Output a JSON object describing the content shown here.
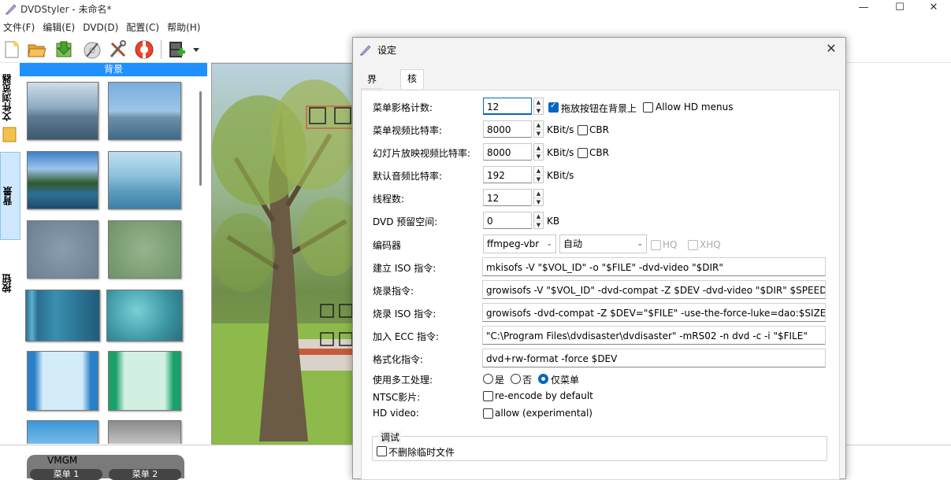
{
  "window": {
    "title": "DVDStyler - 未命名*",
    "min": "—",
    "max": "☐",
    "close": "✕"
  },
  "menu": [
    "文件(F)",
    "编辑(E)",
    "DVD(D)",
    "配置(C)",
    "帮助(H)"
  ],
  "toolbar": [
    "new-icon",
    "open-icon",
    "save-icon",
    "burn-icon",
    "settings-icon",
    "help-icon",
    "add-video-icon"
  ],
  "side_tabs": [
    "文件浏览器",
    "背景",
    "按钮"
  ],
  "background_panel": {
    "title": "背景"
  },
  "bottom": {
    "vmgm": "VMGM",
    "menus": [
      "菜单 1",
      "菜单 2"
    ]
  },
  "dialog": {
    "title": "设定",
    "close": "✕",
    "tabs": [
      "界面",
      "核心"
    ],
    "active_tab": "核心",
    "rows": {
      "menu_frame_count": {
        "label": "菜单影格计数:",
        "value": "12",
        "check1": "拖放按钮在背景上",
        "check2": "Allow HD menus"
      },
      "menu_video_bitrate": {
        "label": "菜单视频比特率:",
        "value": "8000",
        "unit": "KBit/s",
        "check": "CBR"
      },
      "slideshow_bitrate": {
        "label": "幻灯片放映视频比特率:",
        "value": "8000",
        "unit": "KBit/s",
        "check": "CBR"
      },
      "audio_bitrate": {
        "label": "默认音频比特率:",
        "value": "192",
        "unit": "KBit/s"
      },
      "threads": {
        "label": "线程数:",
        "value": "12"
      },
      "dvd_reserve": {
        "label": "DVD 预留空间:",
        "value": "0",
        "unit": "KB"
      },
      "encoder": {
        "label": "编码器",
        "value1": "ffmpeg-vbr",
        "value2": "自动",
        "hq": "HQ",
        "xhq": "XHQ"
      },
      "iso_cmd": {
        "label": "建立 ISO 指令:",
        "value": "mkisofs -V \"$VOL_ID\" -o \"$FILE\" -dvd-video \"$DIR\""
      },
      "burn_cmd": {
        "label": "烧录指令:",
        "value": "growisofs -V \"$VOL_ID\" -dvd-compat -Z $DEV -dvd-video \"$DIR\" $SPEEDSTR"
      },
      "burn_iso_cmd": {
        "label": "烧录 ISO 指令:",
        "value": "growisofs -dvd-compat -Z $DEV=\"$FILE\" -use-the-force-luke=dao:$SIZE $SPEEDSTR"
      },
      "ecc_cmd": {
        "label": "加入 ECC 指令:",
        "value": "\"C:\\Program Files\\dvdisaster\\dvdisaster\" -mRS02 -n dvd -c -i \"$FILE\""
      },
      "format_cmd": {
        "label": "格式化指令:",
        "value": "dvd+rw-format -force $DEV"
      },
      "multicore": {
        "label": "使用多工处理:",
        "opt1": "是",
        "opt2": "否",
        "opt3": "仅菜单"
      },
      "ntsc": {
        "label": "NTSC影片:",
        "check": "re-encode by default"
      },
      "hd_video": {
        "label": "HD video:",
        "check": "allow (experimental)"
      }
    },
    "debug": {
      "title": "调试",
      "check": "不删除临时文件"
    }
  }
}
